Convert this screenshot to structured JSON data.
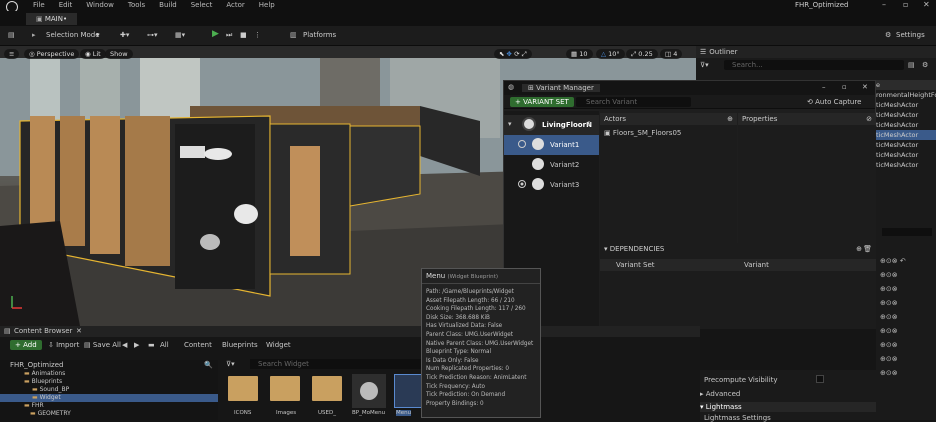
{
  "menubar": {
    "items": [
      "File",
      "Edit",
      "Window",
      "Tools",
      "Build",
      "Select",
      "Actor",
      "Help"
    ],
    "window_title": "FHR_Optimized"
  },
  "tabbar": {
    "tab": "MAIN•"
  },
  "toolbar": {
    "selection_mode": "Selection Mode",
    "platforms": "Platforms",
    "settings": "Settings"
  },
  "viewport": {
    "perspective": "Perspective",
    "lit": "Lit",
    "show": "Show",
    "snap_values": [
      "10",
      "10°",
      "0.25",
      "4"
    ]
  },
  "outliner": {
    "title": "Outliner",
    "search_placeholder": "Search...",
    "partial_rows": [
      "e",
      "ronmentalHeightFo",
      "ticMeshActor",
      "ticMeshActor",
      "ticMeshActor",
      "ticMeshActor",
      "ticMeshActor",
      "ticMeshActor",
      "ticMeshActor"
    ]
  },
  "variant_manager": {
    "title": "Variant Manager",
    "variant_set_btn": "VARIANT SET",
    "search_placeholder": "Search Variant",
    "auto_capture": "Auto Capture",
    "set_name": "LivingFloorN",
    "variants": [
      "Variant1",
      "Variant2",
      "Variant3"
    ],
    "actors_header": "Actors",
    "actor_item": "Floors_SM_Floors05",
    "properties_header": "Properties",
    "dependencies": "DEPENDENCIES",
    "dep_cols": [
      "Variant Set",
      "Variant"
    ]
  },
  "content_browser": {
    "title": "Content Browser",
    "add": "Add",
    "import": "Import",
    "save_all": "Save All",
    "breadcrumb": [
      "All",
      "Content",
      "Blueprints",
      "Widget"
    ],
    "search_placeholder": "Search Widget",
    "tree": [
      "FHR_Optimized",
      "Animations",
      "Blueprints",
      "Sound_BP",
      "Widget",
      "FHR",
      "GEOMETRY"
    ],
    "assets": [
      "ICONS",
      "Images",
      "USED_",
      "BP_MoMenu",
      "Menu"
    ]
  },
  "tooltip": {
    "title": "Menu",
    "subtitle": "(Widget Blueprint)",
    "lines": [
      "Path: /Game/Blueprints/Widget",
      "Asset Filepath Length: 66 / 210",
      "Cooking Filepath Length: 117 / 260",
      "Disk Size: 368.688 KiB",
      "Has Virtualized Data: False",
      "Parent Class: UMG.UserWidget",
      "Native Parent Class: UMG.UserWidget",
      "Blueprint Type: Normal",
      "Is Data Only: False",
      "Num Replicated Properties: 0",
      "Tick Prediction Reason: AnimLatent",
      "Tick Frequency: Auto",
      "Tick Prediction: On Demand",
      "Property Bindings: 0"
    ]
  },
  "details": {
    "precompute": "Precompute Visibility",
    "advanced": "Advanced",
    "lightmass": "Lightmass",
    "lightmass_settings": "Lightmass Settings"
  }
}
